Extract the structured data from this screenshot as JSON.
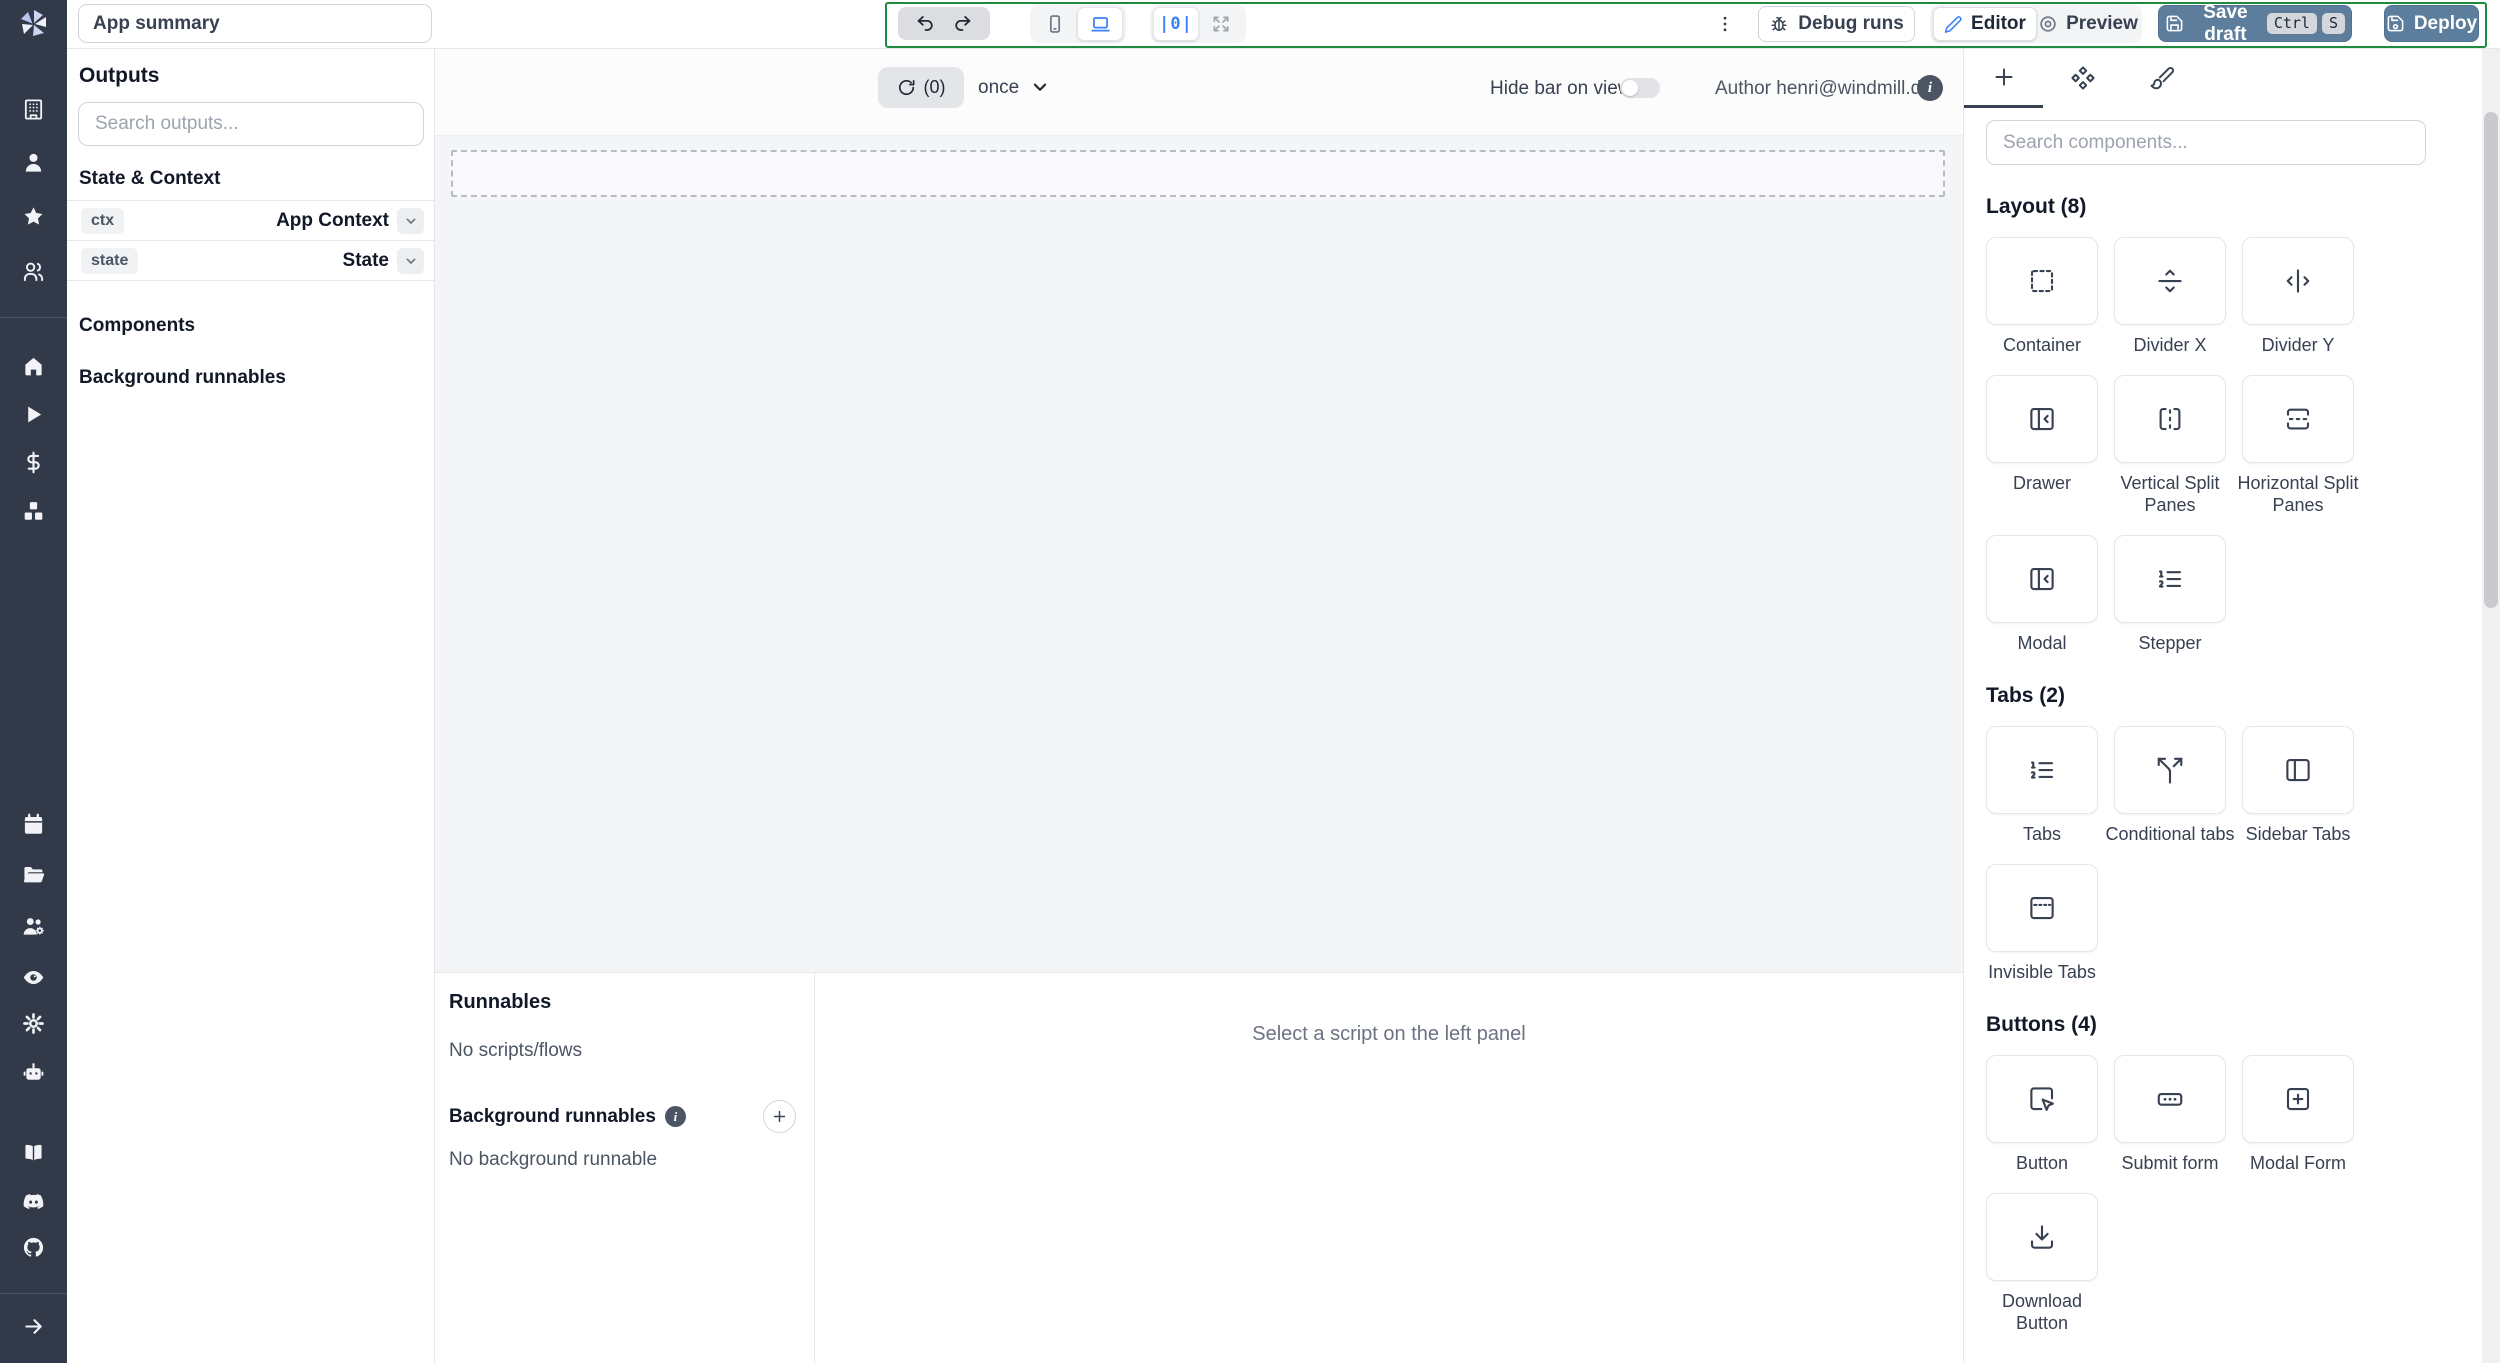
{
  "colors": {
    "rail_bg": "#323a49",
    "steel_blue": "#5d7d9d",
    "accent_blue": "#3b82f6",
    "green_outline": "#1f8b3e"
  },
  "topbar": {
    "app_summary_placeholder": "App summary",
    "debug_runs_label": "Debug runs",
    "editor_label": "Editor",
    "preview_label": "Preview",
    "save_draft_label": "Save draft",
    "kbd": [
      "Ctrl",
      "S"
    ],
    "deploy_label": "Deploy"
  },
  "rail": {
    "top_icons": [
      "building",
      "user",
      "star",
      "users"
    ],
    "mid_icons": [
      "home",
      "play",
      "dollar",
      "boxes"
    ],
    "lower_icons": [
      "calendar",
      "folder",
      "users-cog",
      "eye",
      "gear",
      "bot"
    ],
    "bottom_icons": [
      "book",
      "discord",
      "github"
    ],
    "footer_icon": "arrow-right"
  },
  "outputs_panel": {
    "title": "Outputs",
    "search_placeholder": "Search outputs...",
    "state_context_label": "State & Context",
    "rows": [
      {
        "key": "ctx",
        "value": "App Context"
      },
      {
        "key": "state",
        "value": "State"
      }
    ],
    "components_label": "Components",
    "background_label": "Background runnables"
  },
  "canvas": {
    "refresh_count": "(0)",
    "interval": "once",
    "hide_bar_label": "Hide bar on view",
    "author_label": "Author henri@windmill.dev"
  },
  "runnables": {
    "title": "Runnables",
    "empty": "No scripts/flows",
    "background_title": "Background runnables",
    "background_empty": "No background runnable",
    "select_hint": "Select a script on the left panel"
  },
  "components_panel": {
    "search_placeholder": "Search components...",
    "sections": [
      {
        "title": "Layout (8)",
        "items": [
          {
            "label": "Container",
            "icon": "container"
          },
          {
            "label": "Divider X",
            "icon": "divider-x"
          },
          {
            "label": "Divider Y",
            "icon": "divider-y"
          },
          {
            "label": "Drawer",
            "icon": "panel-left-close"
          },
          {
            "label": "Vertical Split Panes",
            "icon": "vsplit"
          },
          {
            "label": "Horizontal Split Panes",
            "icon": "hsplit"
          },
          {
            "label": "Modal",
            "icon": "panel-left-close"
          },
          {
            "label": "Stepper",
            "icon": "list-ordered"
          }
        ]
      },
      {
        "title": "Tabs (2)",
        "items": [
          {
            "label": "Tabs",
            "icon": "list-ordered"
          },
          {
            "label": "Conditional tabs",
            "icon": "split"
          },
          {
            "label": "Sidebar Tabs",
            "icon": "panel-left"
          },
          {
            "label": "Invisible Tabs",
            "icon": "panel-top-dashed"
          }
        ]
      },
      {
        "title": "Buttons (4)",
        "items": [
          {
            "label": "Button",
            "icon": "square-pointer"
          },
          {
            "label": "Submit form",
            "icon": "form-dots"
          },
          {
            "label": "Modal Form",
            "icon": "square-plus"
          },
          {
            "label": "Download Button",
            "icon": "download"
          }
        ]
      }
    ]
  }
}
